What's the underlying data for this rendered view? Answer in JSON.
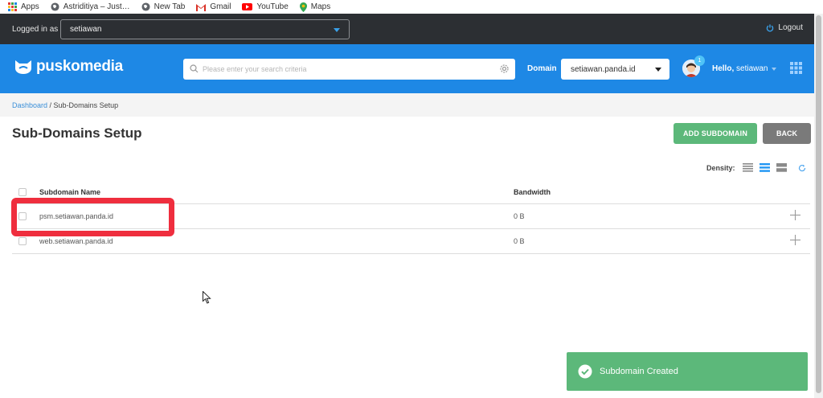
{
  "bookmarks": [
    {
      "label": "Apps",
      "icon": "apps-grid-icon"
    },
    {
      "label": "Astriditiya – Just…",
      "icon": "globe-icon"
    },
    {
      "label": "New Tab",
      "icon": "globe-icon"
    },
    {
      "label": "Gmail",
      "icon": "gmail-icon"
    },
    {
      "label": "YouTube",
      "icon": "youtube-icon"
    },
    {
      "label": "Maps",
      "icon": "maps-icon"
    }
  ],
  "topbar": {
    "logged_in_label": "Logged in as",
    "user_value": "setiawan",
    "logout_label": "Logout"
  },
  "header": {
    "brand": "puskomedia",
    "search_placeholder": "Please enter your search criteria",
    "domain_label": "Domain",
    "domain_value": "setiawan.panda.id",
    "notification_count": "1",
    "hello_prefix": "Hello,",
    "hello_user": "setiawan"
  },
  "breadcrumb": {
    "root": "Dashboard",
    "separator": " / ",
    "current": "Sub-Domains Setup"
  },
  "page": {
    "title": "Sub-Domains Setup",
    "add_button": "ADD SUBDOMAIN",
    "back_button": "BACK",
    "density_label": "Density:"
  },
  "table": {
    "headers": {
      "name": "Subdomain Name",
      "bandwidth": "Bandwidth"
    },
    "rows": [
      {
        "name": "psm.setiawan.panda.id",
        "bandwidth": "0 B"
      },
      {
        "name": "web.setiawan.panda.id",
        "bandwidth": "0 B"
      }
    ]
  },
  "toast": {
    "message": "Subdomain Created"
  },
  "colors": {
    "header_blue": "#1e88e5",
    "topbar_dark": "#2c2f33",
    "success_green": "#5cb87a",
    "highlight_red": "#ef2e3e"
  }
}
